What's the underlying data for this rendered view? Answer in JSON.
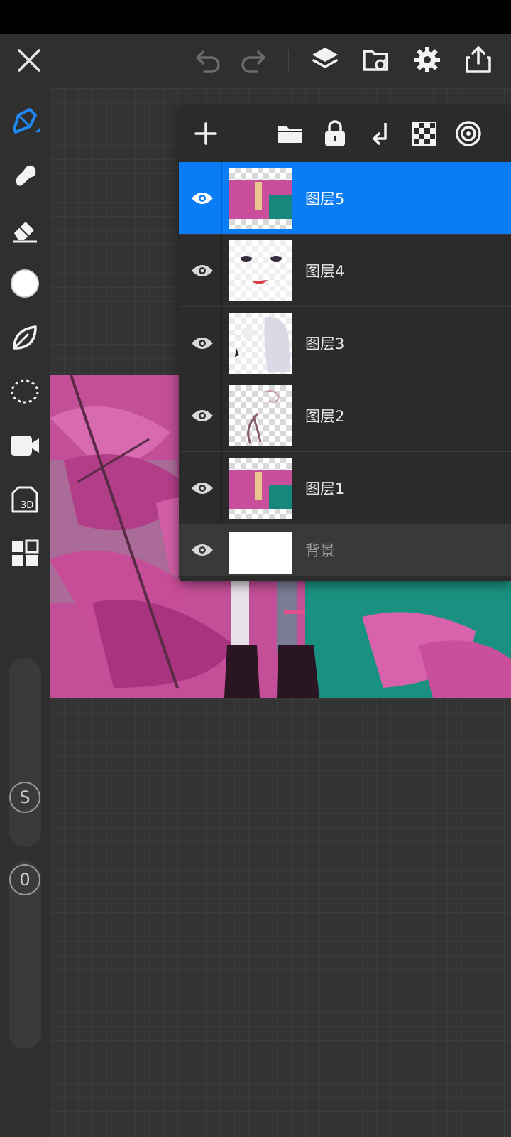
{
  "toolbar": {
    "close": "close",
    "undo": "undo",
    "redo": "redo",
    "layers": "layers",
    "gallery": "gallery",
    "settings": "settings",
    "share": "share"
  },
  "tools": [
    "brush",
    "smudge",
    "eraser",
    "color",
    "leaf-brush",
    "selection",
    "video",
    "3d",
    "grid-panels"
  ],
  "sliders": {
    "size_label": "S",
    "opacity_label": "0"
  },
  "layers_toolbar": [
    "add",
    "folder",
    "lock",
    "merge-down",
    "transparency",
    "blend"
  ],
  "layers": [
    {
      "name": "图层5",
      "selected": true
    },
    {
      "name": "图层4",
      "selected": false
    },
    {
      "name": "图层3",
      "selected": false
    },
    {
      "name": "图层2",
      "selected": false
    },
    {
      "name": "图层1",
      "selected": false
    }
  ],
  "background_layer": {
    "name": "背景"
  },
  "colors": {
    "accent": "#0a7cf5",
    "panel": "#2b2b2b",
    "background": "#2f2f2f"
  }
}
